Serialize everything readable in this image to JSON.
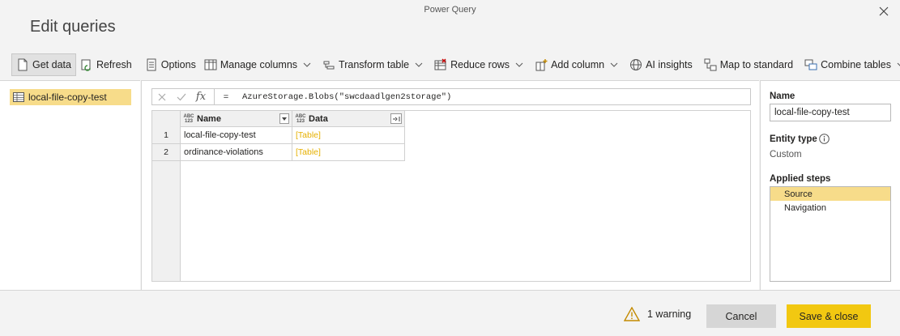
{
  "window": {
    "title": "Power Query"
  },
  "dialog": {
    "title": "Edit queries"
  },
  "toolbar": {
    "items": [
      {
        "label": "Get data",
        "icon": "get-data-icon",
        "has_dropdown": false
      },
      {
        "label": "Refresh",
        "icon": "refresh-icon",
        "has_dropdown": false
      },
      {
        "label": "Options",
        "icon": "options-icon",
        "has_dropdown": false
      },
      {
        "label": "Manage columns",
        "icon": "manage-columns-icon",
        "has_dropdown": true
      },
      {
        "label": "Transform table",
        "icon": "transform-table-icon",
        "has_dropdown": true
      },
      {
        "label": "Reduce rows",
        "icon": "reduce-rows-icon",
        "has_dropdown": true
      },
      {
        "label": "Add column",
        "icon": "add-column-icon",
        "has_dropdown": true
      },
      {
        "label": "AI insights",
        "icon": "ai-insights-icon",
        "has_dropdown": false
      },
      {
        "label": "Map to standard",
        "icon": "map-to-standard-icon",
        "has_dropdown": false
      },
      {
        "label": "Combine tables",
        "icon": "combine-tables-icon",
        "has_dropdown": true
      }
    ]
  },
  "queries": {
    "items": [
      {
        "label": "local-file-copy-test",
        "selected": true
      }
    ]
  },
  "formula_bar": {
    "fx": "fx",
    "equals": "=",
    "formula": "AzureStorage.Blobs(\"swcdaadlgen2storage\")"
  },
  "table": {
    "columns": [
      {
        "type_top": "ABC",
        "type_bottom": "123",
        "label": "Name"
      },
      {
        "type_top": "ABC",
        "type_bottom": "123",
        "label": "Data"
      }
    ],
    "rows": [
      {
        "num": "1",
        "name": "local-file-copy-test",
        "data": "[Table]"
      },
      {
        "num": "2",
        "name": "ordinance-violations",
        "data": "[Table]"
      }
    ]
  },
  "properties": {
    "name_label": "Name",
    "name_value": "local-file-copy-test",
    "entity_type_label": "Entity type",
    "entity_type_value": "Custom",
    "applied_steps_label": "Applied steps",
    "steps": [
      {
        "label": "Source",
        "selected": true
      },
      {
        "label": "Navigation",
        "selected": false
      }
    ]
  },
  "footer": {
    "warning_text": "1 warning",
    "cancel_label": "Cancel",
    "save_label": "Save & close"
  },
  "colors": {
    "accent": "#f2c811",
    "selection": "#f7dc8a",
    "link": "#e6b000"
  }
}
